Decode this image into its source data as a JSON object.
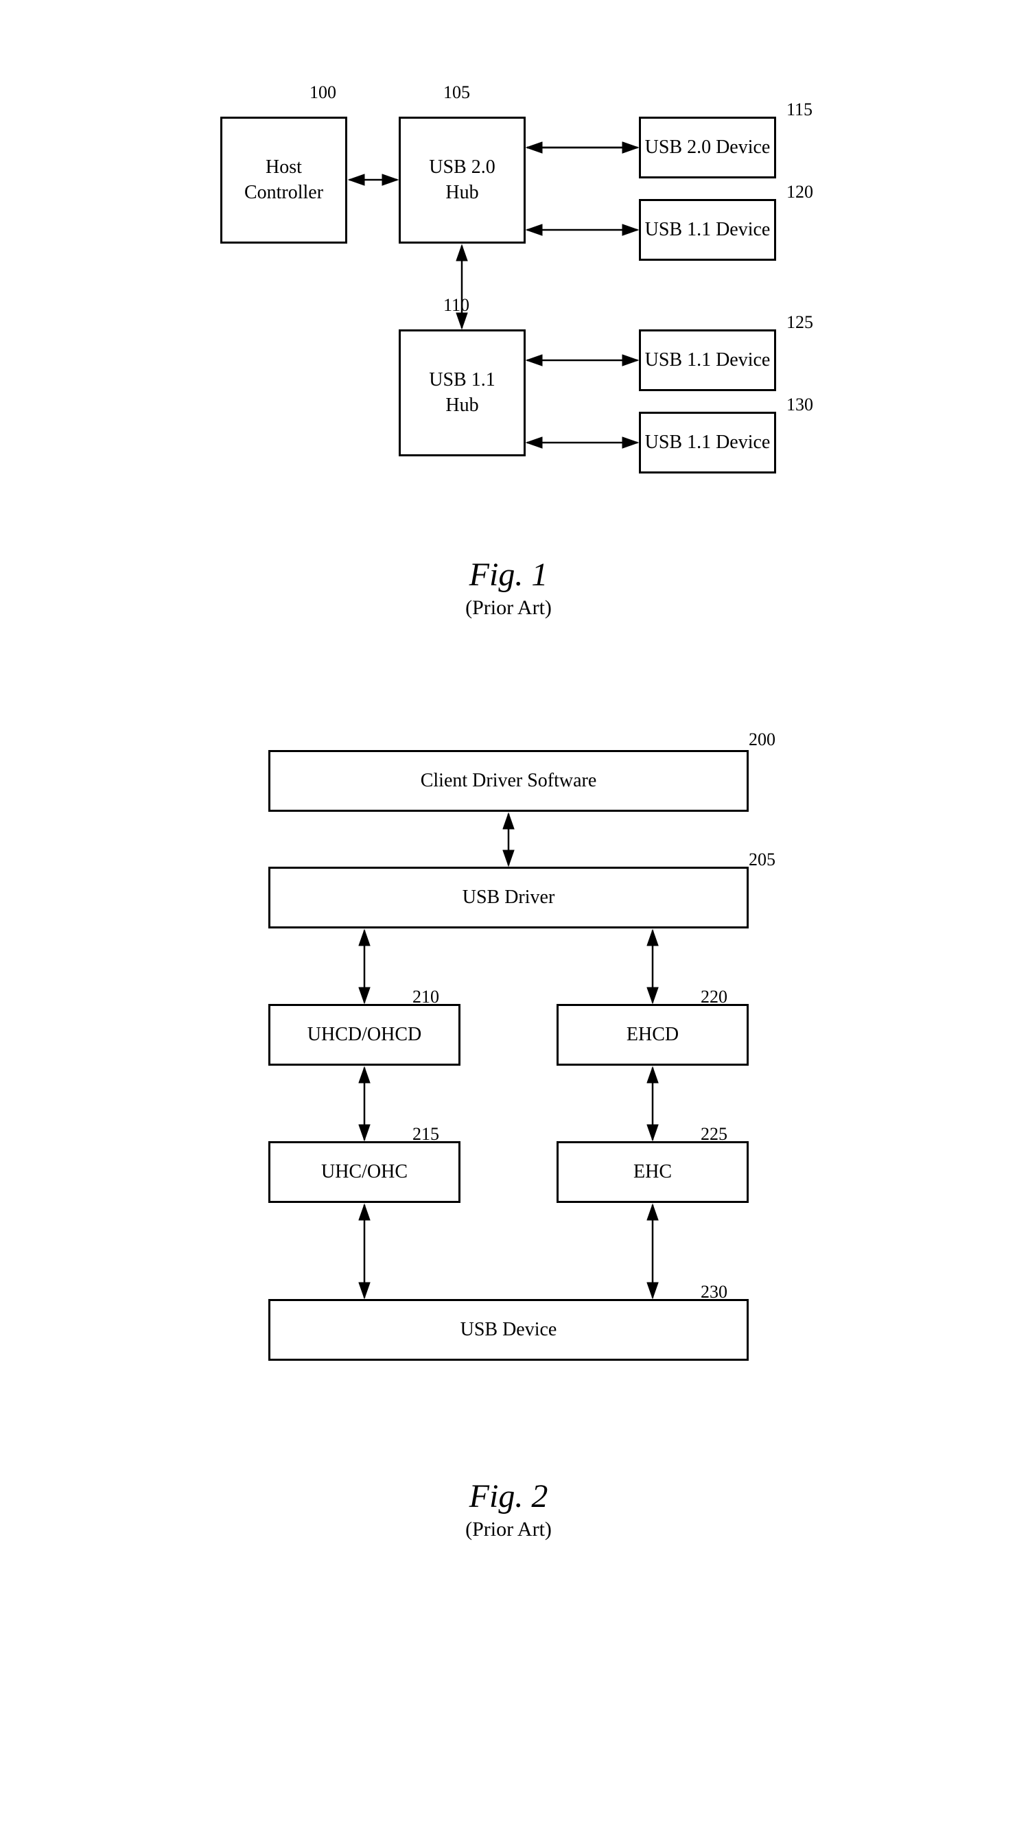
{
  "fig1": {
    "ref_100": "100",
    "ref_105": "105",
    "ref_110": "110",
    "ref_115": "115",
    "ref_120": "120",
    "ref_125": "125",
    "ref_130": "130",
    "host_controller": "Host\nController",
    "usb20hub": "USB 2.0\nHub",
    "usb11hub": "USB 1.1\nHub",
    "usb20device": "USB 2.0 Device",
    "usb11device_120": "USB 1.1 Device",
    "usb11device_125": "USB 1.1 Device",
    "usb11device_130": "USB 1.1 Device",
    "caption_title": "Fig. 1",
    "caption_subtitle": "(Prior Art)"
  },
  "fig2": {
    "ref_200": "200",
    "ref_205": "205",
    "ref_210": "210",
    "ref_215": "215",
    "ref_220": "220",
    "ref_225": "225",
    "ref_230": "230",
    "client_driver": "Client Driver Software",
    "usb_driver": "USB Driver",
    "uhcd_ohcd": "UHCD/OHCD",
    "ehcd": "EHCD",
    "uhc_ohc": "UHC/OHC",
    "ehc": "EHC",
    "usb_device": "USB Device",
    "caption_title": "Fig. 2",
    "caption_subtitle": "(Prior Art)"
  }
}
